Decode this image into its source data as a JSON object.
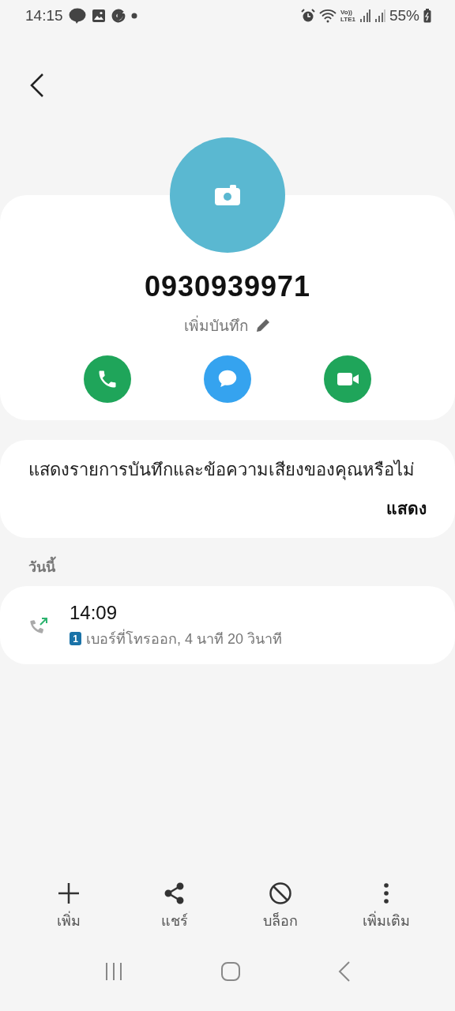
{
  "status_bar": {
    "time": "14:15",
    "network_top": "Vo))",
    "network_bottom": "LTE1",
    "battery": "55%"
  },
  "contact": {
    "number": "0930939971",
    "note_label": "เพิ่มบันทึก"
  },
  "actions": [
    {
      "kind": "call"
    },
    {
      "kind": "message"
    },
    {
      "kind": "video"
    }
  ],
  "prompt": {
    "text": "แสดงรายการบันทึกและข้อความเสียงของคุณหรือไม่",
    "button": "แสดง"
  },
  "section_label": "วันนี้",
  "calls": [
    {
      "kind": "outgoing",
      "time": "14:09",
      "sim": "1",
      "detail": "เบอร์ที่โทรออก, 4 นาที 20 วินาที"
    }
  ],
  "bottom_actions": [
    {
      "kind": "add",
      "label": "เพิ่ม"
    },
    {
      "kind": "share",
      "label": "แชร์"
    },
    {
      "kind": "block",
      "label": "บล็อก"
    },
    {
      "kind": "more",
      "label": "เพิ่มเติม"
    }
  ]
}
